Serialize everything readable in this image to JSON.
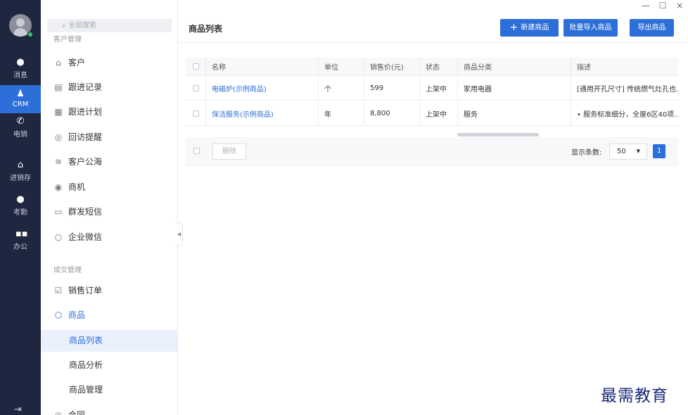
{
  "window": {
    "minimize": "—",
    "maximize": "☐",
    "close": "×"
  },
  "rail": {
    "items": [
      {
        "label": "消息",
        "icon": "chat-icon"
      },
      {
        "label": "CRM",
        "icon": "person-icon"
      },
      {
        "label": "电销",
        "icon": "phone-icon"
      },
      {
        "label": "进销存",
        "icon": "home-icon"
      },
      {
        "label": "考勤",
        "icon": "location-icon"
      },
      {
        "label": "办公",
        "icon": "grid-icon"
      }
    ]
  },
  "sidebar": {
    "search_placeholder": "全局搜索",
    "group_customer": "客户管理",
    "customer_items": [
      "客户",
      "跟进记录",
      "跟进计划",
      "回访提醒",
      "客户公海",
      "商机",
      "群发短信",
      "企业微信"
    ],
    "group_deal": "成交管理",
    "deal_items": [
      "销售订单",
      "商品"
    ],
    "product_sub": [
      "商品列表",
      "商品分析",
      "商品管理"
    ],
    "last_item": "合同"
  },
  "header": {
    "title": "商品列表",
    "new_button": "新建商品",
    "import_button": "批量导入商品",
    "export_button": "导出商品"
  },
  "table": {
    "columns": [
      "名称",
      "单位",
      "销售价(元)",
      "状态",
      "商品分类",
      "描述"
    ],
    "rows": [
      {
        "name": "电磁炉(示例商品)",
        "unit": "个",
        "price": "599",
        "status": "上架中",
        "category": "家用电器",
        "desc": "[通用开孔尺寸] 传统燃气灶孔也..."
      },
      {
        "name": "保洁服务(示例商品)",
        "unit": "年",
        "price": "8,800",
        "status": "上架中",
        "category": "服务",
        "desc": "• 服务标准细分，全屋6区40项..."
      }
    ]
  },
  "footer": {
    "delete_button": "删除",
    "page_size_label": "显示条数:",
    "page_size": "50",
    "current_page": "1"
  },
  "watermark": "最需教育",
  "colors": {
    "accent": "#2d6fd8",
    "rail_bg": "#1f2740"
  }
}
